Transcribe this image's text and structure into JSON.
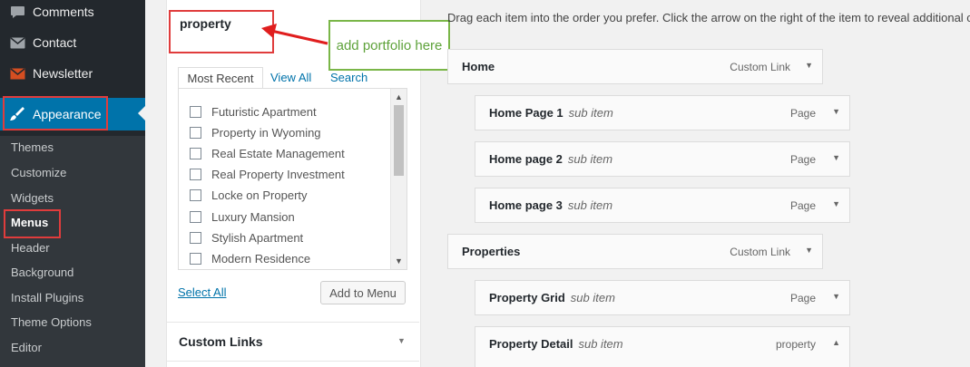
{
  "sidebar": {
    "items": [
      {
        "label": "Comments",
        "icon": "comment-bubble-icon"
      },
      {
        "label": "Contact",
        "icon": "envelope-icon"
      },
      {
        "label": "Newsletter",
        "icon": "newsletter-icon"
      },
      {
        "label": "Appearance",
        "icon": "paintbrush-icon"
      }
    ],
    "submenu": [
      "Themes",
      "Customize",
      "Widgets",
      "Menus",
      "Header",
      "Background",
      "Install Plugins",
      "Theme Options",
      "Editor"
    ],
    "active_color": "#0073aa"
  },
  "panel": {
    "title": "property",
    "tabs": [
      "Most Recent",
      "View All",
      "Search"
    ],
    "items": [
      "Futuristic Apartment",
      "Property in Wyoming",
      "Real Estate Management",
      "Real Property Investment",
      "Locke on Property",
      "Luxury Mansion",
      "Stylish Apartment",
      "Modern Residence"
    ],
    "select_all": "Select All",
    "add_button": "Add to Menu",
    "custom_links": "Custom Links"
  },
  "callout": {
    "text": "add portfolio here"
  },
  "menu": {
    "instructions": "Drag each item into the order you prefer. Click the arrow on the right of the item to reveal additional c",
    "items": [
      {
        "title": "Home",
        "sub": "",
        "type": "Custom Link"
      },
      {
        "title": "Home Page 1",
        "sub": "sub item",
        "type": "Page"
      },
      {
        "title": "Home page 2",
        "sub": "sub item",
        "type": "Page"
      },
      {
        "title": "Home page 3",
        "sub": "sub item",
        "type": "Page"
      },
      {
        "title": "Properties",
        "sub": "",
        "type": "Custom Link"
      },
      {
        "title": "Property Grid",
        "sub": "sub item",
        "type": "Page"
      },
      {
        "title": "Property Detail",
        "sub": "sub item",
        "type": "property"
      }
    ]
  },
  "colors": {
    "highlight_border": "#e03c3c",
    "callout_green": "#7ab648"
  }
}
